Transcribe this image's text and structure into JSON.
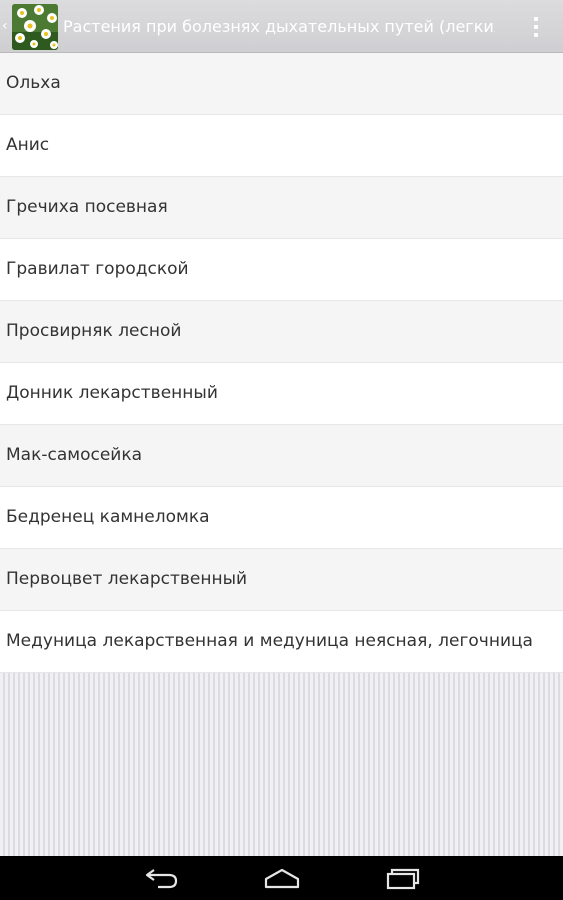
{
  "action_bar": {
    "title": "Растения при болезнях дыхательных путей (легких, г",
    "up_icon": "chevron-left-icon",
    "app_icon": "chamomile-icon",
    "overflow_icon": "more-vertical-icon"
  },
  "list": {
    "items": [
      {
        "label": "Ольха"
      },
      {
        "label": "Анис"
      },
      {
        "label": "Гречиха посевная"
      },
      {
        "label": "Гравилат городской"
      },
      {
        "label": "Просвирняк лесной"
      },
      {
        "label": "Донник лекарственный"
      },
      {
        "label": "Мак-самосейка"
      },
      {
        "label": "Бедренец камнеломка"
      },
      {
        "label": "Первоцвет лекарственный"
      },
      {
        "label": "Медуница лекарственная и медуница неясная, легочница"
      }
    ]
  },
  "nav_bar": {
    "back_icon": "back-icon",
    "home_icon": "home-icon",
    "recents_icon": "recents-icon"
  },
  "colors": {
    "action_bar": "#d4d4d7",
    "list_odd": "#f5f5f5",
    "list_even": "#ffffff",
    "text": "#333333",
    "nav_bar": "#000000"
  }
}
